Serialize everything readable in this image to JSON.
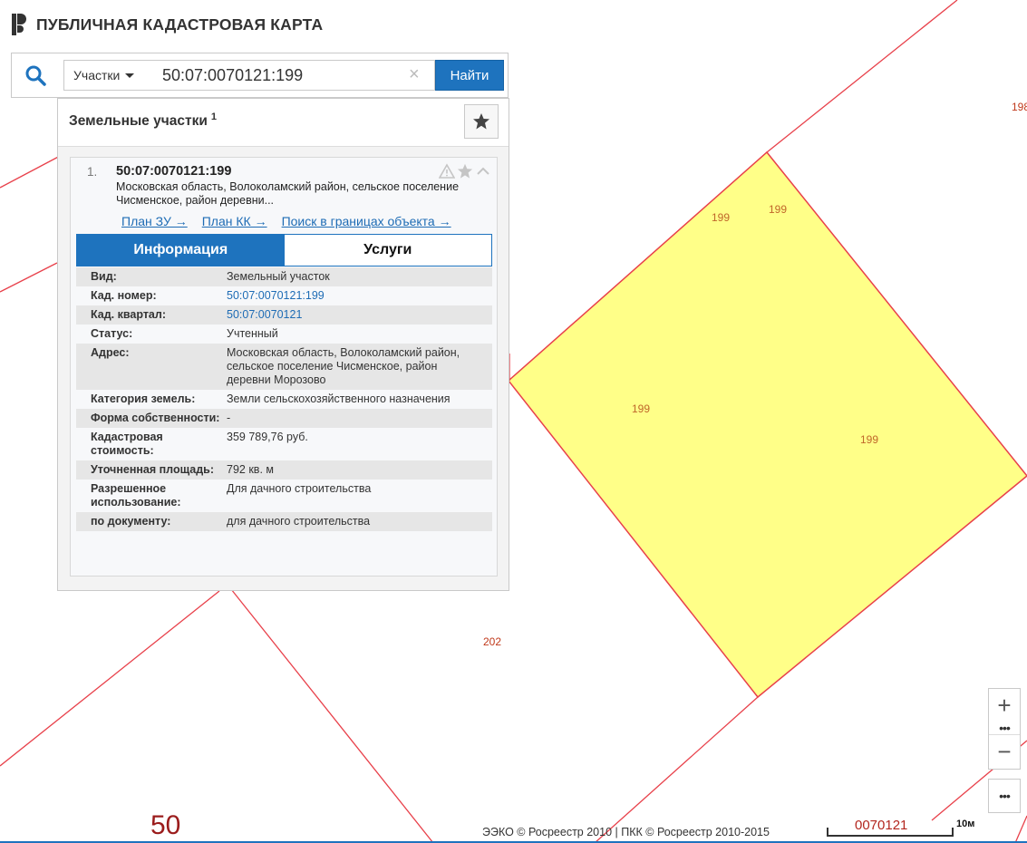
{
  "app": {
    "title": "ПУБЛИЧНАЯ КАДАСТРОВАЯ КАРТА"
  },
  "search": {
    "type_label": "Участки",
    "query": "50:07:0070121:199",
    "clear_symbol": "×",
    "submit_label": "Найти"
  },
  "results": {
    "title": "Земельные участки",
    "count": "1",
    "item": {
      "index": "1.",
      "number": "50:07:0070121:199",
      "address_preview": "Московская область, Волоколамский район, сельское поселение Чисменское, район деревни...",
      "links": [
        {
          "label": "План ЗУ →"
        },
        {
          "label": "План КК →"
        },
        {
          "label": "Поиск в границах объекта →"
        }
      ],
      "tabs": [
        {
          "label": "Информация",
          "active": true
        },
        {
          "label": "Услуги",
          "active": false
        }
      ],
      "info": [
        {
          "key": "Вид:",
          "value": "Земельный участок"
        },
        {
          "key": "Кад. номер:",
          "value": "50:07:0070121:199"
        },
        {
          "key": "Кад. квартал:",
          "value": "50:07:0070121"
        },
        {
          "key": "Статус:",
          "value": "Учтенный"
        },
        {
          "key": "Адрес:",
          "value": "Московская область, Волоколамский район, сельское поселение Чисменское, район деревни Морозово"
        },
        {
          "key": "Категория земель:",
          "value": "Земли сельскохозяйственного назначения"
        },
        {
          "key": "Форма собственности:",
          "value": "-"
        },
        {
          "key": "Кадастровая стоимость:",
          "value": "359 789,76 руб."
        },
        {
          "key": "Уточненная площадь:",
          "value": "792 кв. м"
        },
        {
          "key": "Разрешенное использование:",
          "value": "Для дачного строительства"
        },
        {
          "key": "по документу:",
          "value": "для дачного строительства"
        }
      ]
    }
  },
  "map": {
    "parcel_labels": [
      "199",
      "199",
      "199",
      "199"
    ],
    "neighbor_labels": [
      "202",
      "198"
    ],
    "quarter_label": "0070121",
    "region_label": "50",
    "colors": {
      "parcel_fill": "#ffff88",
      "boundary": "#e8404a",
      "selection": "#1e73be"
    }
  },
  "controls": {
    "zoom_in": "+",
    "zoom_dots": "•••",
    "zoom_out": "−",
    "more": "•••"
  },
  "footer": {
    "attribution": "ЭЭКО © Росреестр 2010 | ПКК © Росреестр 2010-2015",
    "scale": "10м"
  }
}
